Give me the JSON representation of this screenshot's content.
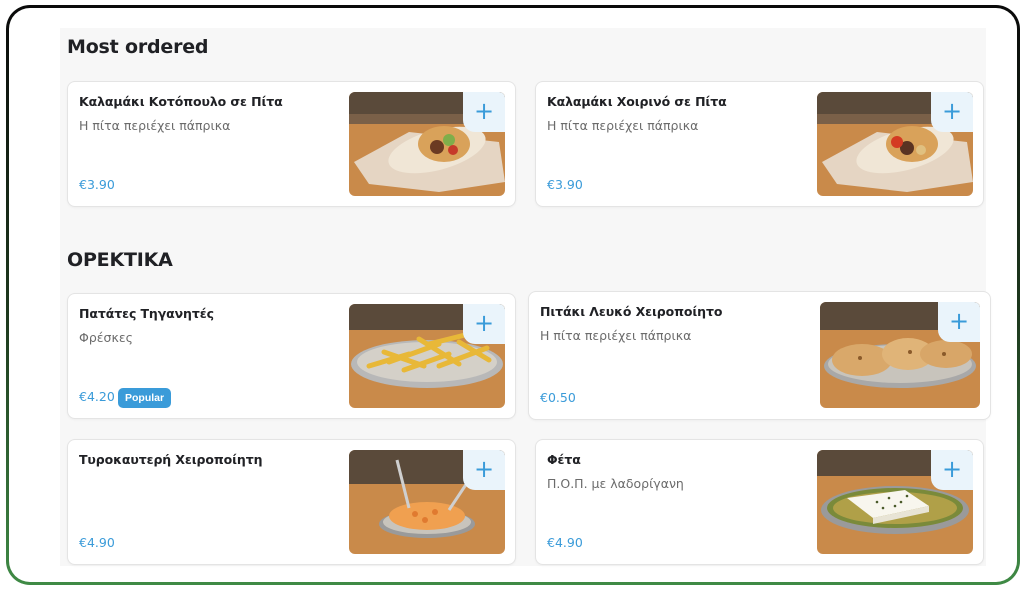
{
  "sections": [
    {
      "title": "Most ordered",
      "items": [
        {
          "name": "Καλαμάκι Κοτόπουλο σε Πίτα",
          "description": "Η πίτα περιέχει πάπρικα",
          "price": "€3.90",
          "add_label": "+"
        },
        {
          "name": "Καλαμάκι Χοιρινό σε Πίτα",
          "description": "Η πίτα περιέχει πάπρικα",
          "price": "€3.90",
          "add_label": "+"
        }
      ]
    },
    {
      "title": "OPEKTIKA",
      "items": [
        {
          "name": "Πατάτες Τηγανητές",
          "description": "Φρέσκες",
          "price": "€4.20",
          "badge": "Popular",
          "add_label": "+"
        },
        {
          "name": "Πιτάκι Λευκό Χειροποίητο",
          "description": "Η πίτα περιέχει πάπρικα",
          "price": "€0.50",
          "add_label": "+"
        },
        {
          "name": "Τυροκαυτερή Χειροποίητη",
          "description": "",
          "price": "€4.90",
          "add_label": "+"
        },
        {
          "name": "Φέτα",
          "description": "Π.Ο.Π. με λαδορίγανη",
          "price": "€4.90",
          "add_label": "+"
        }
      ]
    }
  ],
  "colors": {
    "accent": "#3a9bd9",
    "add_button_bg": "#eaf4fb",
    "frame_top": "#0a0a0a",
    "frame_bottom": "#3f8a45"
  }
}
